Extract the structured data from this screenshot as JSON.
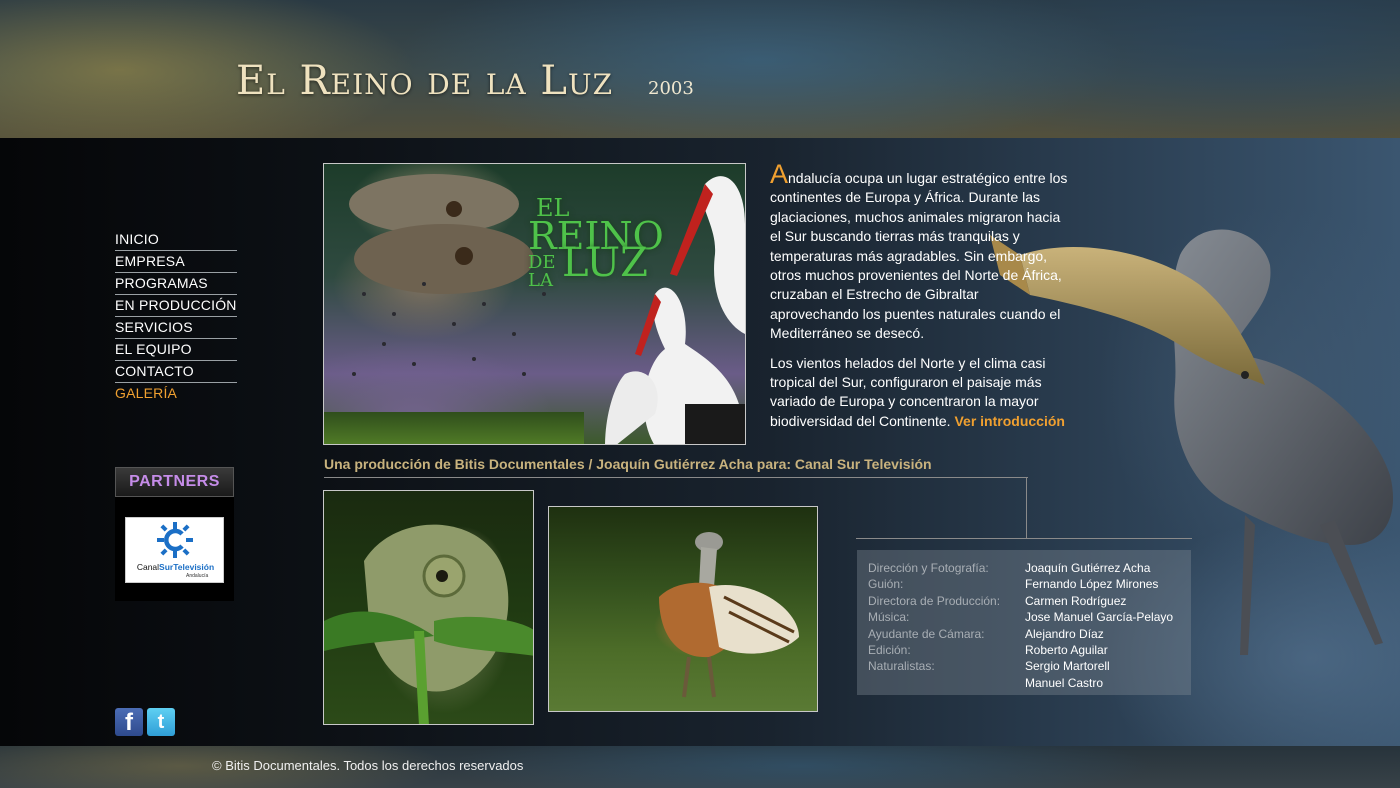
{
  "header": {
    "title": "El Reino de la Luz",
    "year": "2003"
  },
  "nav": {
    "items": [
      {
        "label": "INICIO"
      },
      {
        "label": "EMPRESA"
      },
      {
        "label": "PROGRAMAS"
      },
      {
        "label": "EN PRODUCCIÓN"
      },
      {
        "label": "SERVICIOS"
      },
      {
        "label": "EL EQUIPO"
      },
      {
        "label": "CONTACTO"
      },
      {
        "label": "GALERÍA",
        "active": true
      }
    ]
  },
  "partners": {
    "label": "PARTNERS",
    "logo_text_a": "Canal",
    "logo_text_b": "Sur",
    "logo_text_c": "Televisión",
    "logo_sub": "Andalucía"
  },
  "social": {
    "facebook_glyph": "f",
    "twitter_glyph": "t",
    "facebook_icon": "facebook-icon",
    "twitter_icon": "twitter-icon"
  },
  "hero": {
    "logo_el": "EL",
    "logo_reino": "REINO",
    "logo_de": "DE",
    "logo_la": "LA",
    "logo_luz": "LUZ"
  },
  "intro": {
    "dropcap": "A",
    "paragraph1_rest": "ndalucía ocupa un lugar estratégico entre los continentes de Europa y África. Durante las glaciaciones, muchos animales migraron hacia el Sur buscando tierras más tranquilas y temperaturas más agradables. Sin embargo, otros muchos provenientes del Norte de África, cruzaban el Estrecho de Gibraltar aprovechando los puentes naturales cuando el Mediterráneo se desecó.",
    "paragraph2": "Los vientos helados del Norte y el clima casi tropical  del Sur, configuraron el paisaje más variado de Europa y concentraron la mayor biodiversidad del Continente.",
    "link": "Ver introducción"
  },
  "credit_line": "Una producción de Bitis Documentales / Joaquín Gutiérrez Acha para: Canal Sur Televisión",
  "crew": [
    {
      "role": "Dirección y Fotografía:",
      "name": "Joaquín Gutiérrez Acha"
    },
    {
      "role": "Guión:",
      "name": "Fernando López Mirones"
    },
    {
      "role": "Directora de Producción:",
      "name": "Carmen Rodríguez"
    },
    {
      "role": "Música:",
      "name": "Jose Manuel García-Pelayo"
    },
    {
      "role": "Ayudante de Cámara:",
      "name": "Alejandro Díaz"
    },
    {
      "role": "Edición:",
      "name": "Roberto Aguilar"
    },
    {
      "role": "Naturalistas:",
      "name": "Sergio Martorell"
    },
    {
      "role": "",
      "name": "Manuel Castro"
    }
  ],
  "footer": "© Bitis Documentales. Todos los derechos reservados",
  "colors": {
    "accent": "#f0a030",
    "credit": "#c9b37e",
    "partners": "#c58ce8"
  }
}
